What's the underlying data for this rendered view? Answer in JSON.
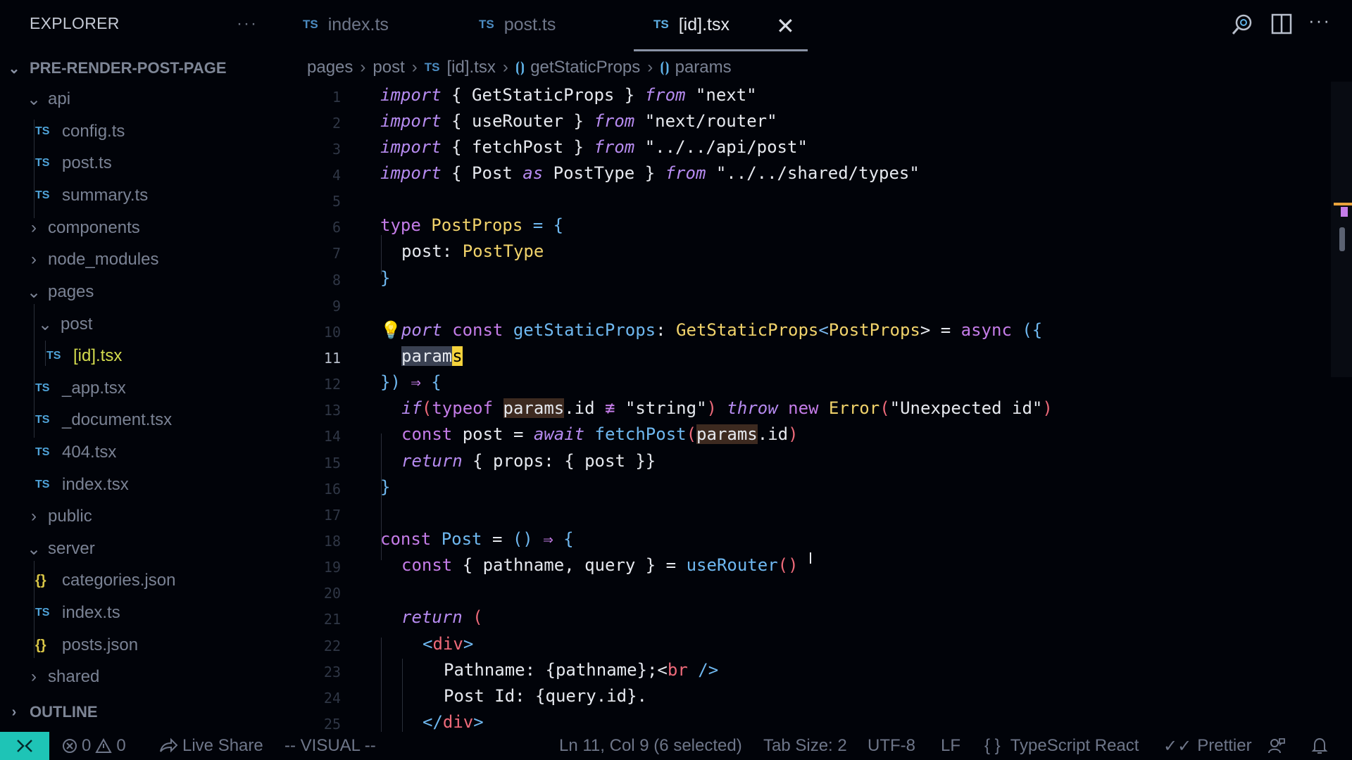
{
  "explorer": {
    "title": "EXPLORER",
    "more": "···",
    "project": "PRE-RENDER-POST-PAGE",
    "outline": "OUTLINE"
  },
  "tree": [
    {
      "label": "api",
      "kind": "folder",
      "open": true
    },
    {
      "label": "config.ts",
      "kind": "ts"
    },
    {
      "label": "post.ts",
      "kind": "ts"
    },
    {
      "label": "summary.ts",
      "kind": "ts"
    },
    {
      "label": "components",
      "kind": "folder",
      "open": false
    },
    {
      "label": "node_modules",
      "kind": "folder",
      "open": false
    },
    {
      "label": "pages",
      "kind": "folder",
      "open": true
    },
    {
      "label": "post",
      "kind": "folder",
      "open": true
    },
    {
      "label": "[id].tsx",
      "kind": "ts",
      "active": true
    },
    {
      "label": "_app.tsx",
      "kind": "ts"
    },
    {
      "label": "_document.tsx",
      "kind": "ts"
    },
    {
      "label": "404.tsx",
      "kind": "ts"
    },
    {
      "label": "index.tsx",
      "kind": "ts"
    },
    {
      "label": "public",
      "kind": "folder",
      "open": false
    },
    {
      "label": "server",
      "kind": "folder",
      "open": true
    },
    {
      "label": "categories.json",
      "kind": "json"
    },
    {
      "label": "index.ts",
      "kind": "ts"
    },
    {
      "label": "posts.json",
      "kind": "json"
    },
    {
      "label": "shared",
      "kind": "folder",
      "open": false
    }
  ],
  "file_badges": {
    "ts": "TS",
    "json": "{}"
  },
  "tabs": [
    {
      "label": "index.ts"
    },
    {
      "label": "post.ts"
    },
    {
      "label": "[id].tsx",
      "active": true
    }
  ],
  "breadcrumb": {
    "parts": [
      "pages",
      "post",
      "[id].tsx",
      "getStaticProps",
      "params"
    ]
  },
  "editor": {
    "line_numbers": [
      "1",
      "2",
      "3",
      "4",
      "5",
      "6",
      "7",
      "8",
      "9",
      "10",
      "11",
      "12",
      "13",
      "14",
      "15",
      "16",
      "17",
      "18",
      "19",
      "20",
      "21",
      "22",
      "23",
      "24",
      "25"
    ],
    "current_line": "11"
  },
  "code": {
    "l1": {
      "a": "import",
      "b": " { GetStaticProps } ",
      "c": "from",
      "d": " \"next\""
    },
    "l2": {
      "a": "import",
      "b": " { useRouter } ",
      "c": "from",
      "d": " \"next/router\""
    },
    "l3": {
      "a": "import",
      "b": " { fetchPost } ",
      "c": "from",
      "d": " \"../../api/post\""
    },
    "l4": {
      "a": "import",
      "b": " { Post ",
      "c": "as",
      "d": " PostType } ",
      "e": "from",
      "f": " \"../../shared/types\""
    },
    "l6": {
      "a": "type",
      "b": " PostProps",
      "c": " = {"
    },
    "l7": {
      "a": "post: ",
      "b": "PostType"
    },
    "l8": {
      "a": "}"
    },
    "l10": {
      "a": "e",
      "b": "port",
      "c": " const",
      "d": " getStaticProps",
      "e": ": ",
      "f": "GetStaticProps",
      "g": "<",
      "h": "PostProps",
      "i": "> = ",
      "j": "async",
      "k": " ({"
    },
    "l11": {
      "a": "param",
      "b": "s"
    },
    "l12": {
      "a": "})",
      "b": " ⇒ ",
      "c": "{"
    },
    "l13": {
      "a": "if",
      "b": "(",
      "c": "typeof",
      "d": "params",
      "e": ".id",
      "f": " ≢ ",
      "g": "\"string\"",
      "h": ")",
      "i": " throw",
      "j": " new",
      "k": " Error",
      "l": "(",
      "m": "\"Unexpected id\"",
      "n": ")"
    },
    "l14": {
      "a": "const",
      "b": " post = ",
      "c": "await",
      "d": " fetchPost",
      "e": "(",
      "f": "params",
      "g": ".id",
      "h": ")"
    },
    "l15": {
      "a": "return",
      "b": " { props: { post }}"
    },
    "l16": {
      "a": "}"
    },
    "l18": {
      "a": "const",
      "b": " Post",
      "c": " = ",
      "d": "()",
      "e": " ⇒ ",
      "f": "{"
    },
    "l19": {
      "a": "const",
      "b": " { pathname, query } = ",
      "c": "useRouter",
      "d": "()"
    },
    "l21": {
      "a": "return",
      "b": " ("
    },
    "l22": {
      "a": "<",
      "b": "div",
      "c": ">"
    },
    "l23": {
      "a": "Pathname: {pathname};<",
      "b": "br",
      "c": " />"
    },
    "l24": {
      "a": "Post Id: {query.id}."
    },
    "l25": {
      "a": "</",
      "b": "div",
      "c": ">"
    }
  },
  "status": {
    "errors": "0",
    "warnings": "0",
    "live_share": "Live Share",
    "mode": "-- VISUAL --",
    "position": "Ln 11, Col 9 (6 selected)",
    "tab_size": "Tab Size: 2",
    "encoding": "UTF-8",
    "eol": "LF",
    "braces": "{ }",
    "language": "TypeScript React",
    "formatter": "Prettier"
  },
  "colors": {
    "remote_accent": "#1ec4b6",
    "cursor_highlight": "#f5d33c",
    "keyword": "#c47ce8",
    "type": "#f1d36b",
    "function": "#6fb8f0"
  }
}
